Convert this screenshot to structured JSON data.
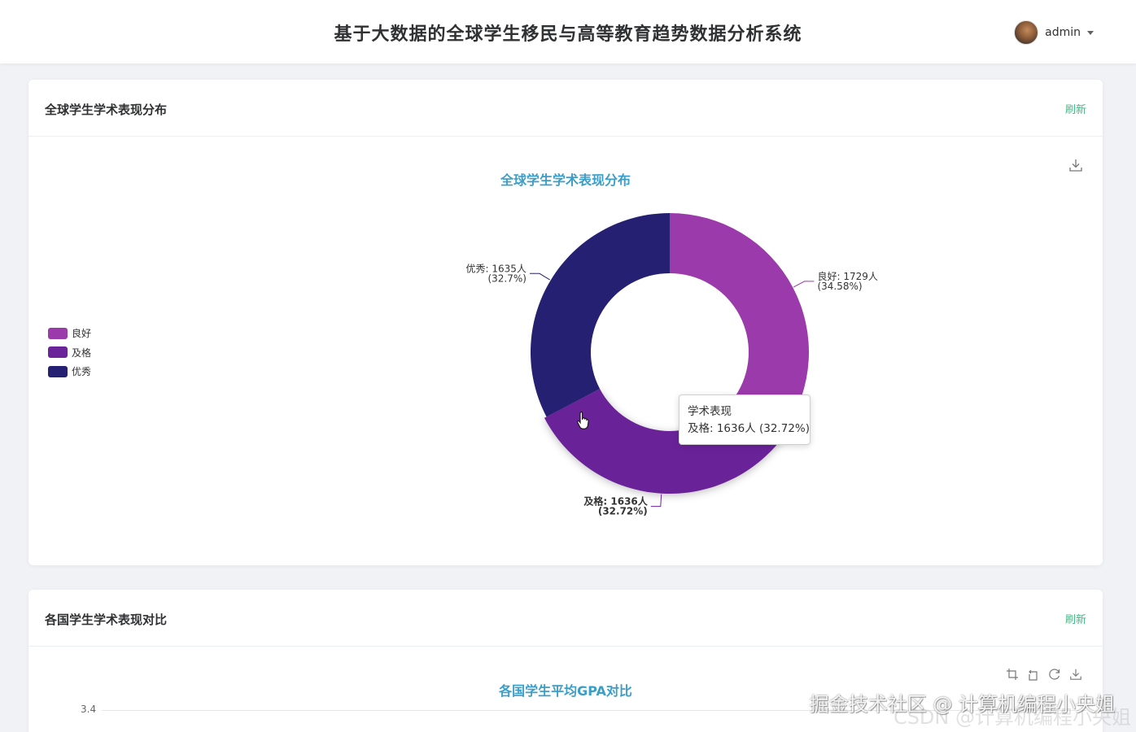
{
  "header": {
    "title": "基于大数据的全球学生移民与高等教育趋势数据分析系统",
    "user": {
      "name": "admin"
    }
  },
  "panel_academic_distribution": {
    "title": "全球学生学术表现分布",
    "refresh_label": "刷新",
    "chart_title": "全球学生学术表现分布",
    "tooltip": {
      "title": "学术表现",
      "line": "及格: 1636人 (32.72%)"
    }
  },
  "panel_country_comparison": {
    "title": "各国学生学术表现对比",
    "refresh_label": "刷新",
    "chart_title": "各国学生平均GPA对比",
    "y_tick_top": "3.4"
  },
  "chart_data": [
    {
      "type": "pie",
      "style": "donut",
      "title": "全球学生学术表现分布",
      "series_name": "学术表现",
      "legend_position": "left",
      "slices": [
        {
          "name": "良好",
          "value": 1729,
          "percent": "34.58%",
          "label_line1": "良好: 1729人",
          "label_line2": "(34.58%)",
          "color": "#9b3aaa",
          "emphasis": false
        },
        {
          "name": "及格",
          "value": 1636,
          "percent": "32.72%",
          "label_line1": "及格: 1636人",
          "label_line2": "(32.72%)",
          "color": "#6a2399",
          "emphasis": true
        },
        {
          "name": "优秀",
          "value": 1635,
          "percent": "32.7%",
          "label_line1": "优秀: 1635人",
          "label_line2": "(32.7%)",
          "color": "#262072",
          "emphasis": false
        }
      ]
    },
    {
      "type": "bar",
      "title": "各国学生平均GPA对比",
      "y_ticks_visible": [
        "3.4"
      ]
    }
  ],
  "watermark": {
    "line1": "掘金技术社区 @ 计算机编程小央姐",
    "line2": "CSDN @计算机编程小央姐"
  }
}
